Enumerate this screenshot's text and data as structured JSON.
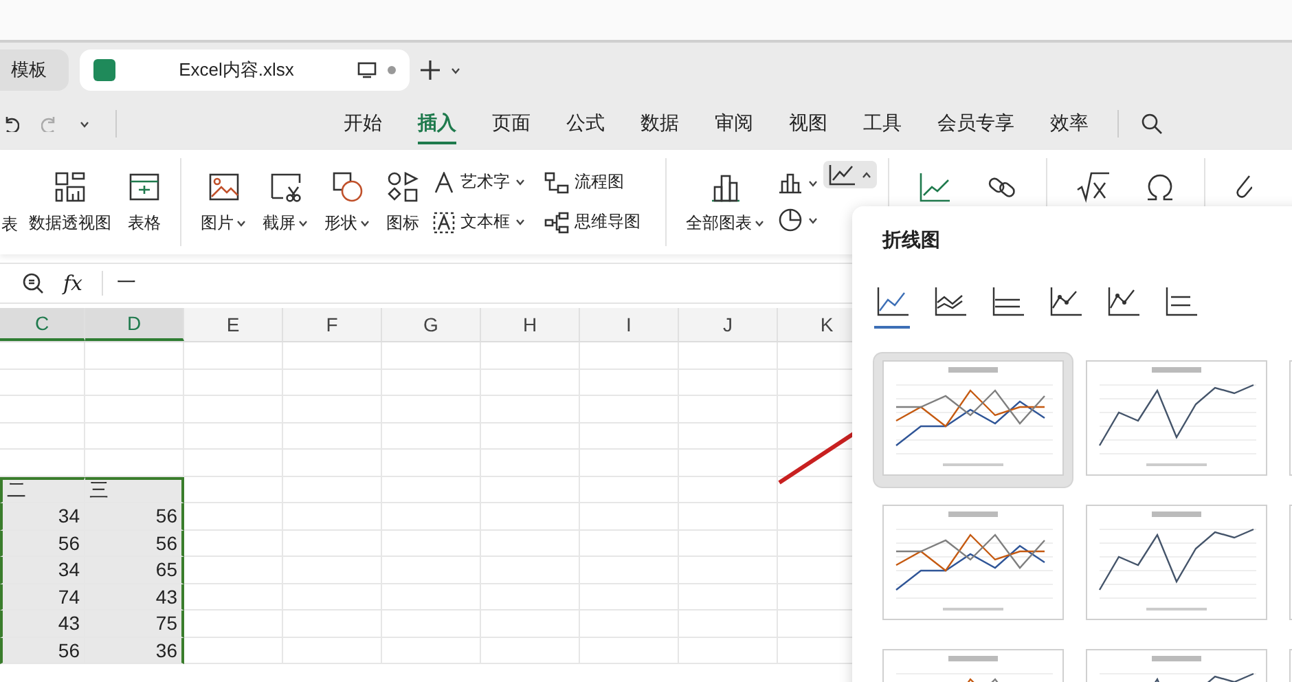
{
  "browser_tabs": [
    {
      "label": "模板",
      "selected": false
    },
    {
      "label": "Excel内容.xlsx",
      "selected": true
    }
  ],
  "menu_tabs": [
    {
      "label": "开始",
      "selected": false
    },
    {
      "label": "插入",
      "selected": true
    },
    {
      "label": "页面",
      "selected": false
    },
    {
      "label": "公式",
      "selected": false
    },
    {
      "label": "数据",
      "selected": false
    },
    {
      "label": "审阅",
      "selected": false
    },
    {
      "label": "视图",
      "selected": false
    },
    {
      "label": "工具",
      "selected": false
    },
    {
      "label": "会员专享",
      "selected": false
    },
    {
      "label": "效率",
      "selected": false
    }
  ],
  "ribbon": {
    "partial_label": "表",
    "items": [
      {
        "kind": "pivot",
        "label": "数据透视图",
        "dropdown": false
      },
      {
        "kind": "table",
        "label": "表格",
        "dropdown": false
      },
      {
        "kind": "divider"
      },
      {
        "kind": "picture",
        "label": "图片",
        "dropdown": true
      },
      {
        "kind": "screenshot",
        "label": "截屏",
        "dropdown": true
      },
      {
        "kind": "shape",
        "label": "形状",
        "dropdown": true
      },
      {
        "kind": "icons",
        "label": "图标",
        "dropdown": false
      },
      {
        "kind": "textpair",
        "top": {
          "label": "艺术字",
          "dropdown": true
        },
        "bottom": {
          "label": "文本框",
          "dropdown": true
        }
      },
      {
        "kind": "diagrampair",
        "top": {
          "label": "流程图",
          "dropdown": false
        },
        "bottom": {
          "label": "思维导图",
          "dropdown": false
        }
      },
      {
        "kind": "divider"
      },
      {
        "kind": "allcharts",
        "label": "全部图表",
        "dropdown": true
      },
      {
        "kind": "charticons"
      },
      {
        "kind": "divider"
      },
      {
        "kind": "sparkline"
      },
      {
        "kind": "link"
      },
      {
        "kind": "divider"
      },
      {
        "kind": "formula"
      },
      {
        "kind": "symbol"
      },
      {
        "kind": "divider"
      },
      {
        "kind": "clip"
      }
    ]
  },
  "formula_bar": {
    "function_label": "fx",
    "content": "一"
  },
  "sheet": {
    "columns": [
      {
        "label": "C",
        "selected": true
      },
      {
        "label": "D",
        "selected": true
      },
      {
        "label": "E",
        "selected": false
      },
      {
        "label": "F",
        "selected": false
      },
      {
        "label": "G",
        "selected": false
      },
      {
        "label": "H",
        "selected": false
      },
      {
        "label": "I",
        "selected": false
      },
      {
        "label": "J",
        "selected": false
      },
      {
        "label": "K",
        "selected": false
      }
    ],
    "rows": [
      {
        "kind": "blank",
        "selected": false
      },
      {
        "kind": "blank",
        "selected": false
      },
      {
        "kind": "blank",
        "selected": false
      },
      {
        "kind": "blank",
        "selected": false
      },
      {
        "kind": "blank",
        "selected": false
      },
      {
        "kind": "header",
        "selected": true,
        "cells": [
          "二",
          "三"
        ]
      },
      {
        "kind": "number",
        "selected": true,
        "cells": [
          "34",
          "56"
        ]
      },
      {
        "kind": "number",
        "selected": true,
        "cells": [
          "56",
          "56"
        ]
      },
      {
        "kind": "number",
        "selected": true,
        "cells": [
          "34",
          "65"
        ]
      },
      {
        "kind": "number",
        "selected": true,
        "cells": [
          "74",
          "43"
        ]
      },
      {
        "kind": "number",
        "selected": true,
        "cells": [
          "43",
          "75"
        ]
      },
      {
        "kind": "number",
        "selected": true,
        "cells": [
          "56",
          "36"
        ]
      }
    ]
  },
  "chart_panel": {
    "title": "折线图",
    "chart_types": [
      {
        "selected": true
      },
      {
        "selected": false
      },
      {
        "selected": false
      },
      {
        "selected": false
      },
      {
        "selected": false
      },
      {
        "selected": false
      }
    ],
    "templates": [
      {
        "selected": true
      },
      {
        "selected": false
      },
      {
        "selected": false
      },
      {
        "selected": false
      },
      {
        "selected": false
      },
      {
        "selected": false
      },
      {
        "selected": false
      },
      {
        "selected": false
      },
      {
        "selected": false
      }
    ]
  }
}
